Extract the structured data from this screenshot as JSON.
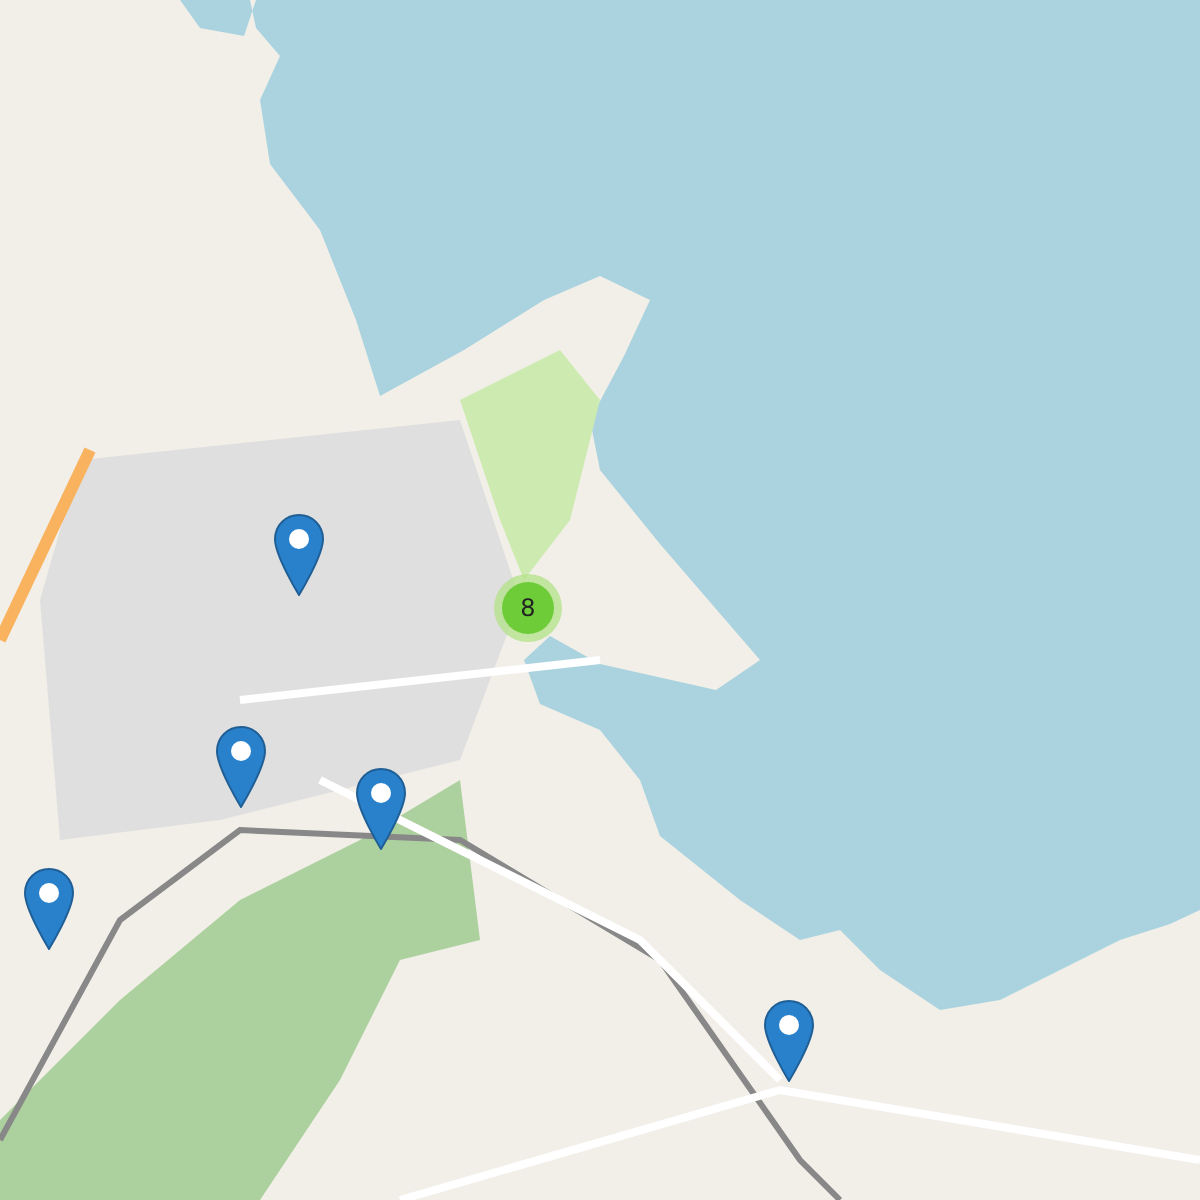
{
  "map": {
    "markers": [
      {
        "kind": "pin"
      },
      {
        "kind": "pin"
      },
      {
        "kind": "pin"
      },
      {
        "kind": "pin"
      },
      {
        "kind": "pin"
      }
    ],
    "clusters": [
      {
        "count": "8"
      }
    ]
  }
}
